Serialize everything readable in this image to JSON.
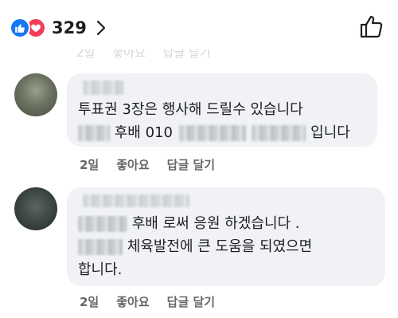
{
  "top_bar": {
    "reaction_icons": [
      "like-icon",
      "love-icon"
    ],
    "reaction_count": "329",
    "like_button_icon": "thumbs-up-icon"
  },
  "comments": [
    {
      "avatar_icon": "avatar",
      "lines": [
        {
          "text": "투표권 3장은 행사해 드릴수 있습니다"
        },
        {
          "prefix": "후배 010",
          "suffix": "입니다"
        }
      ],
      "time": "2일",
      "like_label": "좋아요",
      "reply_label": "답글 달기"
    },
    {
      "avatar_icon": "avatar",
      "lines": [
        {
          "text": "후배 로써 응원 하겠습니다 ."
        },
        {
          "text": "체육발전에 큰 도움을 되였으면"
        },
        {
          "text": "합니다."
        }
      ],
      "time": "2일",
      "like_label": "좋아요",
      "reply_label": "답글 달기"
    }
  ],
  "colors": {
    "like_blue": "#1877f2",
    "love_red": "#f33e58",
    "bubble_bg": "#f0f2f5",
    "meta_gray": "#65676b"
  }
}
